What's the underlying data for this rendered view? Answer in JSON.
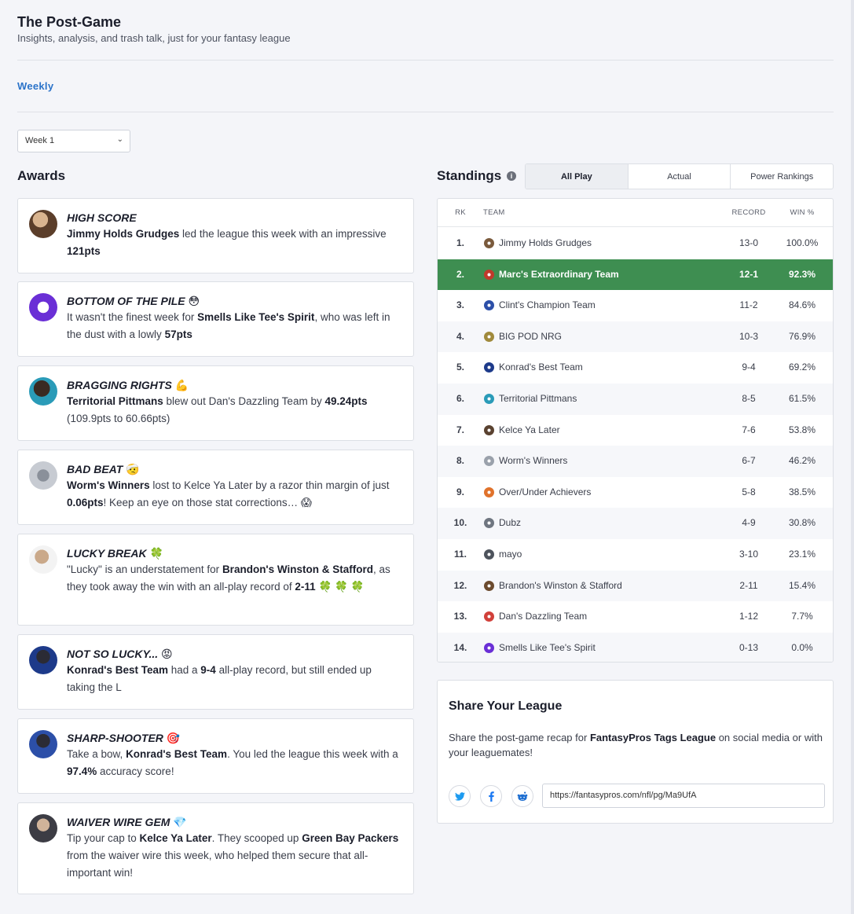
{
  "header": {
    "title": "The Post-Game",
    "subtitle": "Insights, analysis, and trash talk, just for your fantasy league"
  },
  "nav": {
    "weekly_tab": "Weekly"
  },
  "week_select": {
    "value": "Week 1"
  },
  "awards": {
    "heading": "Awards",
    "items": [
      {
        "title": "HIGH SCORE",
        "emoji": "",
        "parts": [
          [
            "b",
            "Jimmy Holds Grudges"
          ],
          [
            "t",
            " led the league this week with an impressive "
          ],
          [
            "b",
            "121pts"
          ]
        ]
      },
      {
        "title": "BOTTOM OF THE PILE",
        "emoji": "😳",
        "parts": [
          [
            "t",
            "It wasn't the finest week for "
          ],
          [
            "b",
            "Smells Like Tee's Spirit"
          ],
          [
            "t",
            ", who was left in the dust with a lowly "
          ],
          [
            "b",
            "57pts"
          ]
        ]
      },
      {
        "title": "BRAGGING RIGHTS",
        "emoji": "💪",
        "parts": [
          [
            "b",
            "Territorial Pittmans"
          ],
          [
            "t",
            " blew out Dan's Dazzling Team by "
          ],
          [
            "b",
            "49.24pts"
          ],
          [
            "t",
            " (109.9pts to 60.66pts)"
          ]
        ]
      },
      {
        "title": "BAD BEAT",
        "emoji": "🤕",
        "parts": [
          [
            "b",
            "Worm's Winners"
          ],
          [
            "t",
            " lost to Kelce Ya Later by a razor thin margin of just "
          ],
          [
            "b",
            "0.06pts"
          ],
          [
            "t",
            "! Keep an eye on those stat corrections… 😱"
          ]
        ]
      },
      {
        "title": "LUCKY BREAK",
        "emoji": "🍀",
        "parts": [
          [
            "t",
            "\"Lucky\" is an understatement for "
          ],
          [
            "b",
            "Brandon's Winston & Stafford"
          ],
          [
            "t",
            ", as they took away the win with an all-play record of "
          ],
          [
            "b",
            "2-11"
          ],
          [
            "t",
            " 🍀 🍀 🍀"
          ]
        ]
      },
      {
        "title": "NOT SO LUCKY...",
        "emoji": "😡",
        "parts": [
          [
            "b",
            "Konrad's Best Team"
          ],
          [
            "t",
            " had a "
          ],
          [
            "b",
            "9-4"
          ],
          [
            "t",
            " all-play record, but still ended up taking the L"
          ]
        ]
      },
      {
        "title": "SHARP-SHOOTER",
        "emoji": "🎯",
        "parts": [
          [
            "t",
            "Take a bow, "
          ],
          [
            "b",
            "Konrad's Best Team"
          ],
          [
            "t",
            ". You led the league this week with a "
          ],
          [
            "b",
            "97.4%"
          ],
          [
            "t",
            " accuracy score!"
          ]
        ]
      },
      {
        "title": "WAIVER WIRE GEM",
        "emoji": "💎",
        "parts": [
          [
            "t",
            "Tip your cap to "
          ],
          [
            "b",
            "Kelce Ya Later"
          ],
          [
            "t",
            ". They scooped up "
          ],
          [
            "b",
            "Green Bay Packers"
          ],
          [
            "t",
            " from the waiver wire this week, who helped them secure that all-important win!"
          ]
        ]
      }
    ]
  },
  "standings": {
    "heading": "Standings",
    "tabs": [
      "All Play",
      "Actual",
      "Power Rankings"
    ],
    "active_tab": "All Play",
    "columns": {
      "rk": "RK",
      "team": "TEAM",
      "record": "RECORD",
      "win": "WIN %"
    },
    "rows": [
      {
        "rk": "1.",
        "team": "Jimmy Holds Grudges",
        "record": "13-0",
        "win": "100.0%",
        "color": "#7a5a3c"
      },
      {
        "rk": "2.",
        "team": "Marc's Extraordinary Team",
        "record": "12-1",
        "win": "92.3%",
        "color": "#c0392b",
        "highlight": true
      },
      {
        "rk": "3.",
        "team": "Clint's Champion Team",
        "record": "11-2",
        "win": "84.6%",
        "color": "#2c4fa8"
      },
      {
        "rk": "4.",
        "team": "BIG POD NRG",
        "record": "10-3",
        "win": "76.9%",
        "color": "#a08a3c"
      },
      {
        "rk": "5.",
        "team": "Konrad's Best Team",
        "record": "9-4",
        "win": "69.2%",
        "color": "#1d3a8a"
      },
      {
        "rk": "6.",
        "team": "Territorial Pittmans",
        "record": "8-5",
        "win": "61.5%",
        "color": "#2a9bb8"
      },
      {
        "rk": "7.",
        "team": "Kelce Ya Later",
        "record": "7-6",
        "win": "53.8%",
        "color": "#5a4230"
      },
      {
        "rk": "8.",
        "team": "Worm's Winners",
        "record": "6-7",
        "win": "46.2%",
        "color": "#9aa1ab"
      },
      {
        "rk": "9.",
        "team": "Over/Under Achievers",
        "record": "5-8",
        "win": "38.5%",
        "color": "#e0722b"
      },
      {
        "rk": "10.",
        "team": "Dubz",
        "record": "4-9",
        "win": "30.8%",
        "color": "#6f7680"
      },
      {
        "rk": "11.",
        "team": "mayo",
        "record": "3-10",
        "win": "23.1%",
        "color": "#4d535c"
      },
      {
        "rk": "12.",
        "team": "Brandon's Winston & Stafford",
        "record": "2-11",
        "win": "15.4%",
        "color": "#6b4a2e"
      },
      {
        "rk": "13.",
        "team": "Dan's Dazzling Team",
        "record": "1-12",
        "win": "7.7%",
        "color": "#d1403a"
      },
      {
        "rk": "14.",
        "team": "Smells Like Tee's Spirit",
        "record": "0-13",
        "win": "0.0%",
        "color": "#6a2fd6"
      }
    ]
  },
  "share": {
    "title": "Share Your League",
    "text_before": "Share the post-game recap for ",
    "league": "FantasyPros Tags League",
    "text_after": " on social media or with your leaguemates!",
    "url": "https://fantasypros.com/nfl/pg/Ma9UfA",
    "icons": [
      "twitter-icon",
      "facebook-icon",
      "reddit-icon"
    ]
  },
  "colors": {
    "accent": "#2b73c9",
    "highlight_row": "#3e8e51",
    "twitter": "#1d9bf0",
    "facebook": "#1877f2",
    "reddit": "#1f6fd1"
  }
}
